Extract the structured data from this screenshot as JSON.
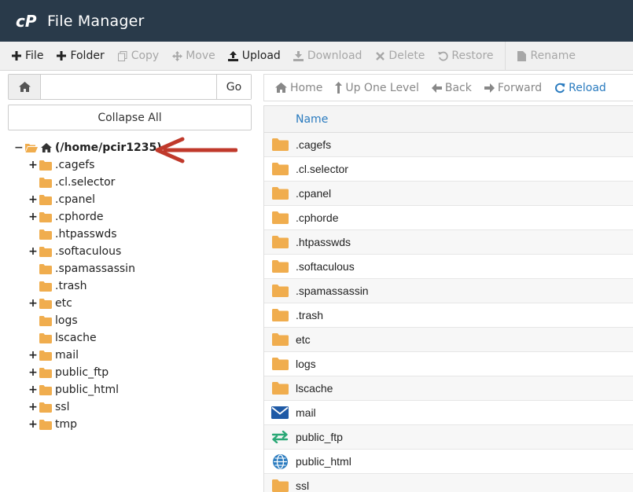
{
  "app": {
    "title": "File Manager"
  },
  "toolbar": {
    "items": [
      {
        "label": "File",
        "icon": "plus-icon",
        "disabled": false
      },
      {
        "label": "Folder",
        "icon": "plus-icon",
        "disabled": false
      },
      {
        "label": "Copy",
        "icon": "copy-icon",
        "disabled": true
      },
      {
        "label": "Move",
        "icon": "move-icon",
        "disabled": true
      },
      {
        "label": "Upload",
        "icon": "upload-icon",
        "disabled": false
      },
      {
        "label": "Download",
        "icon": "download-icon",
        "disabled": true
      },
      {
        "label": "Delete",
        "icon": "delete-icon",
        "disabled": true
      },
      {
        "label": "Restore",
        "icon": "restore-icon",
        "disabled": true
      },
      {
        "label": "Rename",
        "icon": "rename-icon",
        "disabled": true
      }
    ]
  },
  "path": {
    "value": "",
    "go_label": "Go"
  },
  "collapse_label": "Collapse All",
  "tree": {
    "root_label": "(/home/pcir1235)",
    "items": [
      {
        "label": ".cagefs",
        "expandable": true
      },
      {
        "label": ".cl.selector",
        "expandable": false
      },
      {
        "label": ".cpanel",
        "expandable": true
      },
      {
        "label": ".cphorde",
        "expandable": true
      },
      {
        "label": ".htpasswds",
        "expandable": false
      },
      {
        "label": ".softaculous",
        "expandable": true
      },
      {
        "label": ".spamassassin",
        "expandable": false
      },
      {
        "label": ".trash",
        "expandable": false
      },
      {
        "label": "etc",
        "expandable": true
      },
      {
        "label": "logs",
        "expandable": false
      },
      {
        "label": "lscache",
        "expandable": false
      },
      {
        "label": "mail",
        "expandable": true
      },
      {
        "label": "public_ftp",
        "expandable": true
      },
      {
        "label": "public_html",
        "expandable": true
      },
      {
        "label": "ssl",
        "expandable": true
      },
      {
        "label": "tmp",
        "expandable": true
      }
    ]
  },
  "nav": {
    "items": [
      {
        "label": "Home",
        "icon": "home-icon",
        "active": false
      },
      {
        "label": "Up One Level",
        "icon": "up-level-icon",
        "active": false
      },
      {
        "label": "Back",
        "icon": "back-arrow-icon",
        "active": false
      },
      {
        "label": "Forward",
        "icon": "forward-arrow-icon",
        "active": false
      },
      {
        "label": "Reload",
        "icon": "reload-icon",
        "active": true
      }
    ]
  },
  "table": {
    "header_name": "Name",
    "rows": [
      {
        "name": ".cagefs",
        "icon": "folder"
      },
      {
        "name": ".cl.selector",
        "icon": "folder"
      },
      {
        "name": ".cpanel",
        "icon": "folder"
      },
      {
        "name": ".cphorde",
        "icon": "folder"
      },
      {
        "name": ".htpasswds",
        "icon": "folder"
      },
      {
        "name": ".softaculous",
        "icon": "folder"
      },
      {
        "name": ".spamassassin",
        "icon": "folder"
      },
      {
        "name": ".trash",
        "icon": "folder"
      },
      {
        "name": "etc",
        "icon": "folder"
      },
      {
        "name": "logs",
        "icon": "folder"
      },
      {
        "name": "lscache",
        "icon": "folder"
      },
      {
        "name": "mail",
        "icon": "mail"
      },
      {
        "name": "public_ftp",
        "icon": "ftp"
      },
      {
        "name": "public_html",
        "icon": "globe"
      },
      {
        "name": "ssl",
        "icon": "folder"
      }
    ]
  },
  "colors": {
    "header_bg": "#293a4a",
    "folder": "#f0ad4e",
    "link": "#2a7bbf",
    "arrow": "#c0392b"
  }
}
